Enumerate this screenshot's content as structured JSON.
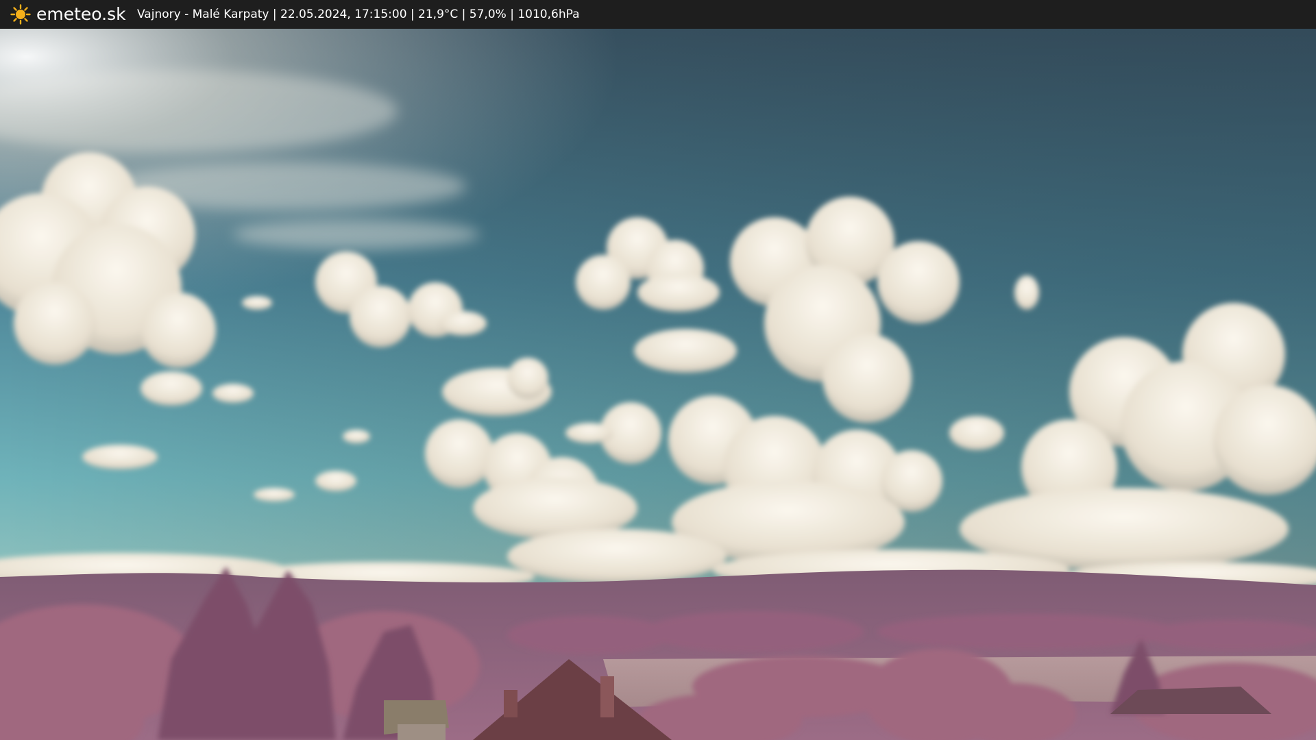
{
  "header": {
    "brand": "emeteo.sk",
    "logo_icon": "sun-icon",
    "caption": "Vajnory - Malé Karpaty | 22.05.2024, 17:15:00 | 21,9°C | 57,0% | 1010,6hPa"
  },
  "colors": {
    "header_bg": "#1e1e1e",
    "header_text": "#ffffff",
    "sun": "#f5b01a",
    "sky_top": "#3e5a6b",
    "sky_horizon": "#6fb3ba",
    "cloud": "#f1ebdc",
    "hills": "#8f5f7f",
    "foliage": "#a0677f",
    "field": "#b29596"
  }
}
